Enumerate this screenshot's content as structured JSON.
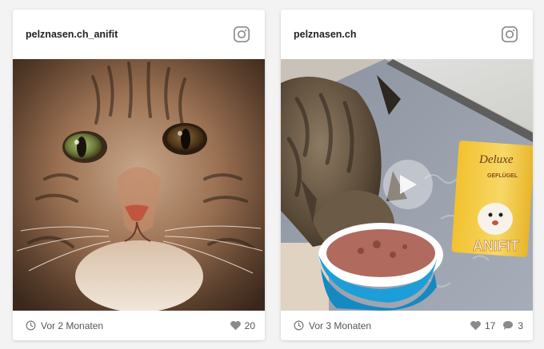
{
  "posts": [
    {
      "username": "pelznasen.ch_anifit",
      "platform_icon": "instagram-icon",
      "media_type": "photo",
      "image_alt": "Close-up of a tabby cat's face",
      "time_ago": "Vor 2 Monaten",
      "likes": "20"
    },
    {
      "username": "pelznasen.ch",
      "platform_icon": "instagram-icon",
      "media_type": "video",
      "image_alt": "Tabby cat eating from a blue bowl next to an Anifit Deluxe food pouch",
      "product_text": {
        "brand_line": "Deluxe",
        "sub_line": "GEFLÜGEL",
        "logo": "ANIFIT"
      },
      "time_ago": "Vor 3 Monaten",
      "likes": "17",
      "comments": "3"
    }
  ],
  "colors": {
    "background": "#f3f3f3",
    "card": "#ffffff",
    "icon_gray": "#8a8a8a",
    "bowl_blue": "#1e9ed8"
  }
}
